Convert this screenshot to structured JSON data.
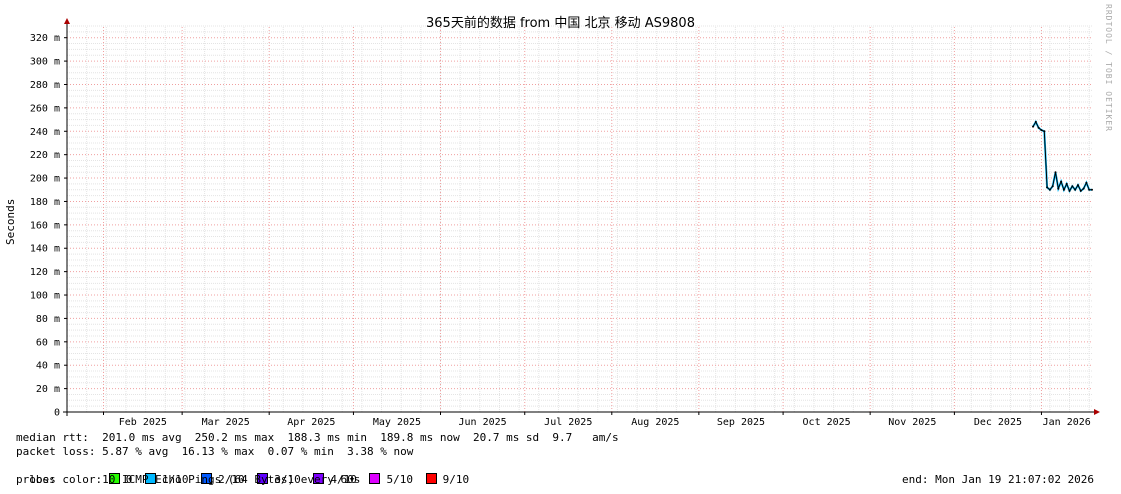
{
  "title": "365天前的数据 from 中国 北京 移动 AS9808",
  "watermark": "RRDTOOL / TOBI OETIKER",
  "chart_data": {
    "type": "line",
    "title": "365天前的数据 from 中国 北京 移动 AS9808",
    "ylabel": "Seconds",
    "ylim": [
      0,
      330
    ],
    "y_unit_suffix": "m",
    "yticks": [
      0,
      20,
      40,
      60,
      80,
      100,
      120,
      140,
      160,
      180,
      200,
      220,
      240,
      260,
      280,
      300,
      320
    ],
    "ytick_labels": [
      "0",
      "20 m",
      "40 m",
      "60 m",
      "80 m",
      "100 m",
      "120 m",
      "140 m",
      "160 m",
      "180 m",
      "200 m",
      "220 m",
      "240 m",
      "260 m",
      "280 m",
      "300 m",
      "320 m"
    ],
    "xticks": [
      "Feb 2025",
      "Mar 2025",
      "Apr 2025",
      "May 2025",
      "Jun 2025",
      "Jul 2025",
      "Aug 2025",
      "Sep 2025",
      "Oct 2025",
      "Nov 2025",
      "Dec 2025",
      "Jan 2026"
    ],
    "xlim": [
      "2025-01-19",
      "2026-01-19"
    ],
    "grid": true,
    "series": [
      {
        "color": "#00bbff",
        "points": [
          [
            "2025-12-29",
            244
          ],
          [
            "2025-12-30",
            248
          ],
          [
            "2025-12-31",
            243
          ],
          [
            "2026-01-01",
            241
          ],
          [
            "2026-01-02",
            240
          ],
          [
            "2026-01-03",
            192
          ],
          [
            "2026-01-04",
            190
          ],
          [
            "2026-01-05",
            193
          ],
          [
            "2026-01-06",
            205
          ],
          [
            "2026-01-07",
            191
          ],
          [
            "2026-01-08",
            197
          ],
          [
            "2026-01-09",
            190
          ],
          [
            "2026-01-10",
            195
          ],
          [
            "2026-01-11",
            189
          ],
          [
            "2026-01-12",
            193
          ],
          [
            "2026-01-13",
            190
          ],
          [
            "2026-01-14",
            194
          ],
          [
            "2026-01-15",
            189
          ],
          [
            "2026-01-16",
            191
          ],
          [
            "2026-01-17",
            196
          ],
          [
            "2026-01-18",
            190
          ],
          [
            "2026-01-19",
            190
          ]
        ]
      }
    ]
  },
  "stats": {
    "median_rtt": "median rtt:  201.0 ms avg  250.2 ms max  188.3 ms min  189.8 ms now  20.7 ms sd  9.7   am/s",
    "packet_loss": "packet loss: 5.87 % avg  16.13 % max  0.07 % min  3.38 % now",
    "loss_color_label": "loss color:",
    "loss_colors": [
      {
        "label": "0",
        "color": "#26ff00"
      },
      {
        "label": "1/10",
        "color": "#00b8ff"
      },
      {
        "label": "2/10",
        "color": "#0059ff"
      },
      {
        "label": "3/10",
        "color": "#5e00ff"
      },
      {
        "label": "4/10",
        "color": "#7e00ff"
      },
      {
        "label": "5/10",
        "color": "#dd00ff"
      },
      {
        "label": "9/10",
        "color": "#ff0000"
      }
    ],
    "probe": "probe:       10 ICMP Echo Pings (64 Bytes) every 60s",
    "end": "end: Mon Jan 19 21:07:02 2026"
  }
}
